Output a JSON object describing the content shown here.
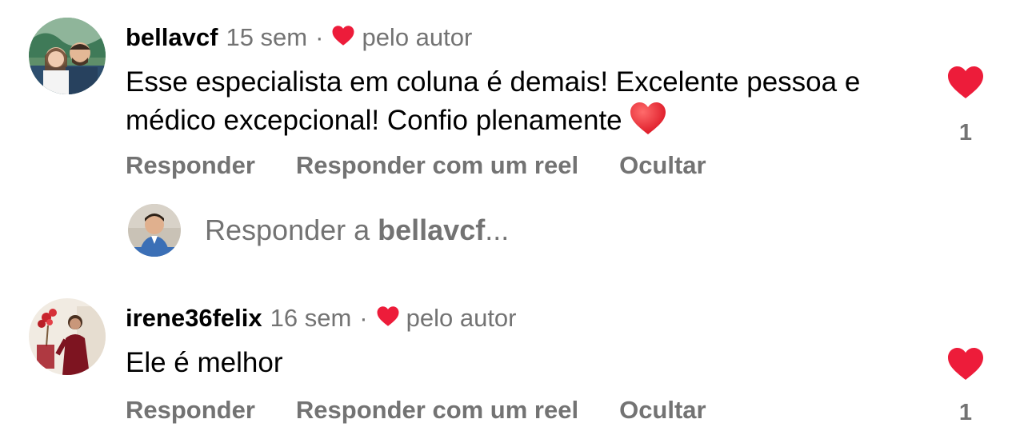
{
  "comments": [
    {
      "username": "bellavcf",
      "time": "15 sem",
      "separator": "·",
      "liked_by_author_label": "pelo autor",
      "text": "Esse especialista em coluna é demais! Excelente pessoa e médico excepcional! Confio plenamente",
      "text_emoji": "red-heart-emoji",
      "actions": {
        "reply": "Responder",
        "reply_reel": "Responder com um reel",
        "hide": "Ocultar"
      },
      "like_icon": "heart-filled-icon",
      "like_count": "1",
      "like_color": "#ed1c3a"
    },
    {
      "username": "irene36felix",
      "time": "16 sem",
      "separator": "·",
      "liked_by_author_label": "pelo autor",
      "text": "Ele é melhor",
      "actions": {
        "reply": "Responder",
        "reply_reel": "Responder com um reel",
        "hide": "Ocultar"
      },
      "like_icon": "heart-filled-icon",
      "like_count": "1",
      "like_color": "#ed1c3a"
    }
  ],
  "reply_box": {
    "prefix": "Responder a ",
    "target_user": "bellavcf",
    "suffix": "..."
  },
  "colors": {
    "secondary_text": "#737373",
    "heart_red": "#ed1c3a"
  }
}
